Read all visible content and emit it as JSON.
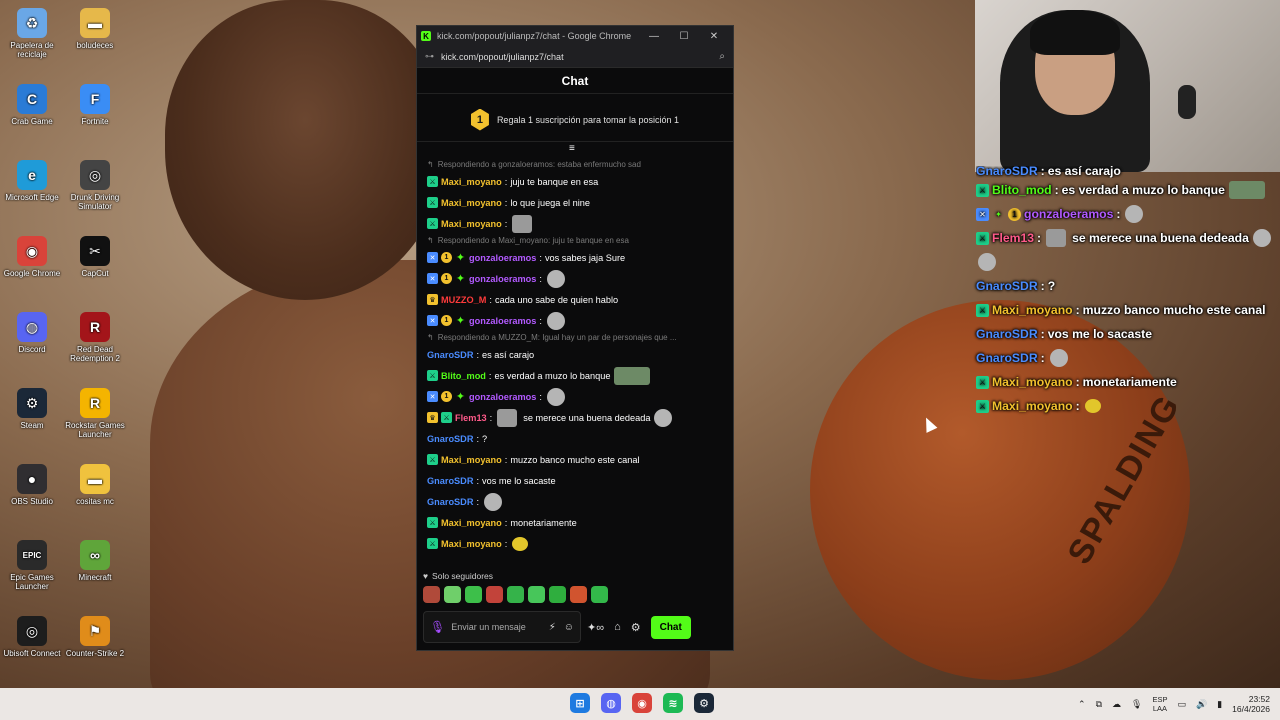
{
  "desktop_icons": [
    {
      "label": "Papelera de reciclaje",
      "icon": "recycle-bin-icon",
      "color": "#6aa7e6",
      "glyph": "♻"
    },
    {
      "label": "boludeces",
      "icon": "folder-icon",
      "color": "#e6b84a",
      "glyph": "▬"
    },
    {
      "label": "Crab Game",
      "icon": "crab-game-icon",
      "color": "#2a7bd6",
      "glyph": "C"
    },
    {
      "label": "Fortnite",
      "icon": "fortnite-icon",
      "color": "#3a8df5",
      "glyph": "F"
    },
    {
      "label": "Microsoft Edge",
      "icon": "edge-icon",
      "color": "#1f9bd8",
      "glyph": "e"
    },
    {
      "label": "Drunk Driving Simulator",
      "icon": "headphones-icon",
      "color": "#444",
      "glyph": "◎"
    },
    {
      "label": "Google Chrome",
      "icon": "chrome-icon",
      "color": "#d9433a",
      "glyph": "◉"
    },
    {
      "label": "CapCut",
      "icon": "capcut-icon",
      "color": "#111",
      "glyph": "✂"
    },
    {
      "label": "Discord",
      "icon": "discord-icon",
      "color": "#5865f2",
      "glyph": "◍"
    },
    {
      "label": "Red Dead Redemption 2",
      "icon": "rdr2-icon",
      "color": "#a3151a",
      "glyph": "R"
    },
    {
      "label": "Steam",
      "icon": "steam-icon",
      "color": "#1b2838",
      "glyph": "⚙"
    },
    {
      "label": "Rockstar Games Launcher",
      "icon": "rockstar-icon",
      "color": "#f4b400",
      "glyph": "R"
    },
    {
      "label": "OBS Studio",
      "icon": "obs-icon",
      "color": "#302e31",
      "glyph": "●"
    },
    {
      "label": "cositas mc",
      "icon": "folder-icon",
      "color": "#f0c23e",
      "glyph": "▬"
    },
    {
      "label": "Epic Games Launcher",
      "icon": "epic-icon",
      "color": "#2a2a2a",
      "glyph": "EPIC"
    },
    {
      "label": "Minecraft",
      "icon": "minecraft-icon",
      "color": "#5fa53a",
      "glyph": "∞"
    },
    {
      "label": "Ubisoft Connect",
      "icon": "ubisoft-icon",
      "color": "#1d1d1d",
      "glyph": "◎"
    },
    {
      "label": "Counter-Strike 2",
      "icon": "cs2-icon",
      "color": "#e08c1a",
      "glyph": "⚑"
    }
  ],
  "wallpaper_text": "SPALDING",
  "window": {
    "title": "kick.com/popout/julianpz7/chat - Google Chrome",
    "favicon": "K",
    "url": "kick.com/popout/julianpz7/chat",
    "minimize": "—",
    "maximize": "☐",
    "close": "✕"
  },
  "chat": {
    "header": "Chat",
    "sub_banner": {
      "position": "1",
      "text": "Regala 1 suscripción para tomar la posición 1"
    },
    "followers_only": "Solo seguidores",
    "input_placeholder": "Enviar un mensaje",
    "send_button": "Chat",
    "colors": {
      "accent": "#53fc18",
      "username_green": "#53fc18",
      "username_blue": "#4a8cff",
      "username_purple": "#b25aff",
      "username_red": "#ff3b3b",
      "username_pink": "#ff5a8a",
      "username_gold": "#f2c12e"
    }
  },
  "messages": [
    {
      "type": "reply",
      "text": "Respondiendo a gonzaloeramos: estaba enfermucho sad"
    },
    {
      "badges": [
        "mod"
      ],
      "user": "Maxi_moyano",
      "color": "#f2c12e",
      "text": "juju te banque en esa",
      "emote": ""
    },
    {
      "badges": [
        "mod"
      ],
      "user": "Maxi_moyano",
      "color": "#f2c12e",
      "text": "lo que juega el nine",
      "emote": ""
    },
    {
      "badges": [
        "mod"
      ],
      "user": "Maxi_moyano",
      "color": "#f2c12e",
      "text": "",
      "emote": "emote"
    },
    {
      "type": "reply",
      "text": "Respondiendo a Maxi_moyano: juju te banque en esa"
    },
    {
      "badges": [
        "vip",
        "sub",
        "og"
      ],
      "user": "gonzaloeramos",
      "color": "#b25aff",
      "text": "vos sabes jaja Sure",
      "emote": ""
    },
    {
      "badges": [
        "vip",
        "sub",
        "og"
      ],
      "user": "gonzaloeramos",
      "color": "#b25aff",
      "text": "",
      "emote": "grey"
    },
    {
      "badges": [
        "crown"
      ],
      "user": "MUZZO_M",
      "color": "#ff3b3b",
      "text": "cada uno sabe de quien hablo",
      "emote": ""
    },
    {
      "badges": [
        "vip",
        "sub",
        "og"
      ],
      "user": "gonzaloeramos",
      "color": "#b25aff",
      "text": "",
      "emote": "grey"
    },
    {
      "type": "reply",
      "text": "Respondiendo a MUZZO_M: Igual hay un par de personajes que ..."
    },
    {
      "badges": [],
      "user": "GnaroSDR",
      "color": "#4a8cff",
      "text": "es así carajo",
      "emote": ""
    },
    {
      "badges": [
        "mod"
      ],
      "user": "Blito_mod",
      "color": "#53fc18",
      "text": "es verdad a muzo lo banque",
      "emote": "wide"
    },
    {
      "badges": [
        "vip",
        "sub",
        "og"
      ],
      "user": "gonzaloeramos",
      "color": "#b25aff",
      "text": "",
      "emote": "grey"
    },
    {
      "badges": [
        "crown",
        "mod"
      ],
      "user": "Flem13",
      "color": "#ff5a8a",
      "text": "se merece una buena dedeada",
      "emote": "grey",
      "pre_emote": true
    },
    {
      "badges": [],
      "user": "GnaroSDR",
      "color": "#4a8cff",
      "text": "?",
      "emote": ""
    },
    {
      "badges": [
        "mod"
      ],
      "user": "Maxi_moyano",
      "color": "#f2c12e",
      "text": "muzzo banco mucho este canal",
      "emote": ""
    },
    {
      "badges": [],
      "user": "GnaroSDR",
      "color": "#4a8cff",
      "text": "vos me lo sacaste",
      "emote": ""
    },
    {
      "badges": [],
      "user": "GnaroSDR",
      "color": "#4a8cff",
      "text": "",
      "emote": "grey"
    },
    {
      "badges": [
        "mod"
      ],
      "user": "Maxi_moyano",
      "color": "#f2c12e",
      "text": "monetariamente",
      "emote": ""
    },
    {
      "badges": [
        "mod"
      ],
      "user": "Maxi_moyano",
      "color": "#f2c12e",
      "text": "",
      "emote": "yellow"
    }
  ],
  "overlay_messages": [
    {
      "badges": [],
      "user": "GnaroSDR",
      "color": "#4a8cff",
      "text": "es así carajo",
      "emote": "",
      "cut": true
    },
    {
      "badges": [
        "mod"
      ],
      "user": "Blito_mod",
      "color": "#53fc18",
      "text": "es verdad a muzo lo banque",
      "emote": "wide"
    },
    {
      "badges": [
        "vip",
        "og",
        "sub"
      ],
      "user": "gonzaloeramos",
      "color": "#b25aff",
      "text": "",
      "emote": "grey"
    },
    {
      "badges": [
        "mod"
      ],
      "user": "Flem13",
      "color": "#ff5a8a",
      "text": "se merece una buena dedeada",
      "emote": "grey",
      "pre_emote": true
    },
    {
      "badges": [],
      "user": "",
      "color": "#ffffff",
      "text": "",
      "emote": "grey"
    },
    {
      "badges": [],
      "user": "GnaroSDR",
      "color": "#4a8cff",
      "text": "?",
      "emote": ""
    },
    {
      "badges": [
        "mod"
      ],
      "user": "Maxi_moyano",
      "color": "#f2c12e",
      "text": "muzzo banco mucho este canal",
      "emote": ""
    },
    {
      "badges": [],
      "user": "GnaroSDR",
      "color": "#4a8cff",
      "text": "vos me lo sacaste",
      "emote": ""
    },
    {
      "badges": [],
      "user": "GnaroSDR",
      "color": "#4a8cff",
      "text": "",
      "emote": "grey"
    },
    {
      "badges": [
        "mod"
      ],
      "user": "Maxi_moyano",
      "color": "#f2c12e",
      "text": "monetariamente",
      "emote": ""
    },
    {
      "badges": [
        "mod"
      ],
      "user": "Maxi_moyano",
      "color": "#f2c12e",
      "text": "",
      "emote": "yellow"
    }
  ],
  "emote_bar": [
    "#b04a3a",
    "#6fcf6a",
    "#3dbf4a",
    "#c2433a",
    "#35b34a",
    "#47c65a",
    "#2fae3e",
    "#d1542f",
    "#33b84a"
  ],
  "taskbar": {
    "apps": [
      {
        "icon": "windows-start-icon",
        "color": "#1e7ae0",
        "glyph": "⊞"
      },
      {
        "icon": "discord-taskbar-icon",
        "color": "#5865f2",
        "glyph": "◍"
      },
      {
        "icon": "chrome-taskbar-icon",
        "color": "#d9433a",
        "glyph": "◉"
      },
      {
        "icon": "spotify-icon",
        "color": "#1db954",
        "glyph": "≋"
      },
      {
        "icon": "steam-taskbar-icon",
        "color": "#1b2838",
        "glyph": "⚙"
      }
    ],
    "lang_top": "ESP",
    "lang_bottom": "LAA",
    "time": "23:52",
    "date": "16/4/2026"
  }
}
